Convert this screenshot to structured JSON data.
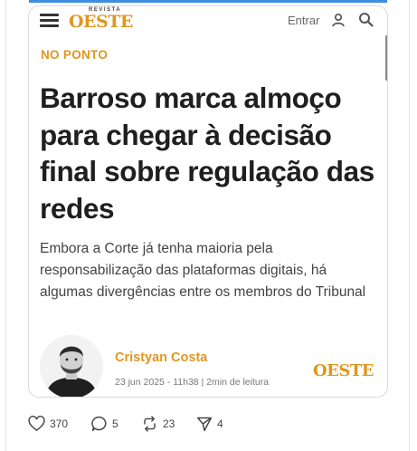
{
  "site": {
    "logo_small": "REVISTA",
    "logo": "OESTE",
    "login_label": "Entrar",
    "icons": [
      "menu-icon",
      "user-icon",
      "search-icon"
    ],
    "accent_color": "#e0961f"
  },
  "article": {
    "kicker": "NO PONTO",
    "headline": "Barroso marca almoço para chegar à decisão final sobre regulação das redes",
    "summary": "Embora a Corte já tenha maioria pela responsabilização das plataformas digitais, há algumas divergências entre os membros do Tribunal",
    "author": "Cristyan Costa",
    "meta": "23 jun 2025 - 11h38 | 2min de leitura",
    "footer_logo": "OESTE"
  },
  "post_actions": {
    "likes": "370",
    "replies": "5",
    "reposts": "23",
    "shares": "4"
  }
}
